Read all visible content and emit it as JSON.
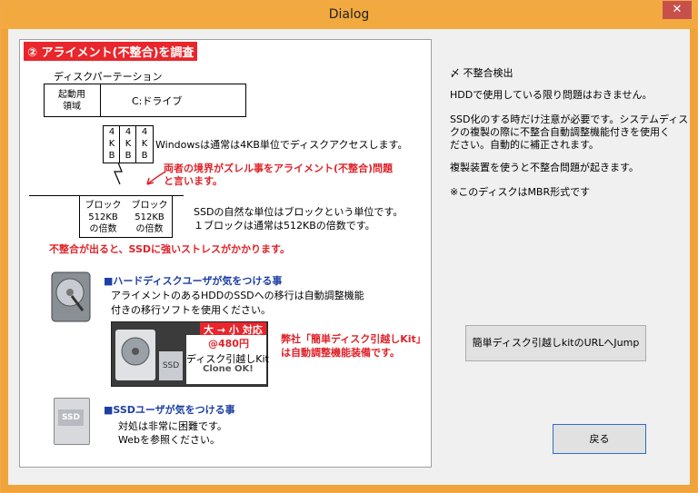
{
  "window": {
    "title": "Dialog",
    "close_glyph": "✕"
  },
  "panel": {
    "header": "② アライメント(不整合)を調査",
    "partition_label": "ディスクパーテーション",
    "boot_area": "起動用\n領域",
    "drive_label": "C:ドライブ",
    "kb_cells": [
      "4\nK\nB",
      "4\nK\nB",
      "4\nK\nB"
    ],
    "windows_note": "Windowsは通常は4KB単位でディスクアクセスします。",
    "misalign_note": "両者の境界がズレル事をアライメント(不整合)問題\nと言います。",
    "block_cells": [
      "ブロック\n512KB\nの倍数",
      "ブロック\n512KB\nの倍数"
    ],
    "ssd_note": "SSDの自然な単位はブロックという単位です。\n１ブロックは通常は512KBの倍数です。",
    "stress_note": "不整合が出ると、SSDに強いストレスがかかります。",
    "hdd_title": "■ハードディスクユーザが気をつける事",
    "hdd_body": "アライメントのあるHDDのSSDへの移行は自動調整機能\n付きの移行ソフトを使用ください。",
    "product_tag": "大 → 小 対応",
    "product_price": "@480円",
    "product_name": "ディスク引越しKit",
    "product_sub": "Clone OK!",
    "product_ssd": "SSD",
    "promo_note": "弊社「簡単ディスク引越しKit」\nは自動調整機能装備です。",
    "ssd_title": "■SSDユーザが気をつける事",
    "ssd_body": "対処は非常に困難です。\nWebを参照ください。",
    "ssd_icon_label": "SSD"
  },
  "right": {
    "check_title": "〆 不整合検出",
    "line1": "HDDで使用している限り問題はおきません。",
    "para2": " SSD化のする時だけ注意が必要です。システムディス\nクの複製の際に不整合自動調整機能付きを使用く\nださい。自動的に補正されます。",
    "line3": " 複製装置を使うと不整合問題が起きます。",
    "line4": "※このディスクはMBR形式です",
    "jump_button": "簡単ディスク引越しkitのURLへJump",
    "back_button": "戻る"
  }
}
